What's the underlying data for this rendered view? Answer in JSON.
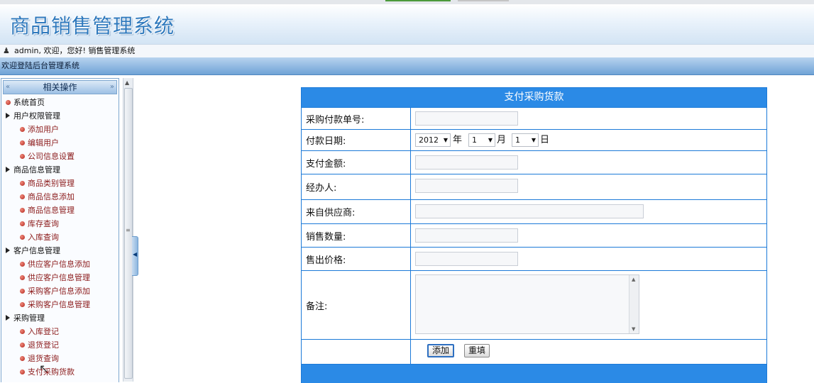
{
  "app": {
    "title": "商品销售管理系统",
    "user_line": "admin, 欢迎，您好! 销售管理系统",
    "welcome": "欢迎登陆后台管理系统"
  },
  "sidebar": {
    "header": "相关操作",
    "items": [
      {
        "label": "系统首页",
        "type": "item"
      },
      {
        "label": "用户权限管理",
        "type": "group"
      },
      {
        "label": "添加用户",
        "type": "sub"
      },
      {
        "label": "编辑用户",
        "type": "sub"
      },
      {
        "label": "公司信息设置",
        "type": "sub"
      },
      {
        "label": "商品信息管理",
        "type": "group"
      },
      {
        "label": "商品类别管理",
        "type": "sub"
      },
      {
        "label": "商品信息添加",
        "type": "sub"
      },
      {
        "label": "商品信息管理",
        "type": "sub"
      },
      {
        "label": "库存查询",
        "type": "sub"
      },
      {
        "label": "入库查询",
        "type": "sub"
      },
      {
        "label": "客户信息管理",
        "type": "group"
      },
      {
        "label": "供应客户信息添加",
        "type": "sub"
      },
      {
        "label": "供应客户信息管理",
        "type": "sub"
      },
      {
        "label": "采购客户信息添加",
        "type": "sub"
      },
      {
        "label": "采购客户信息管理",
        "type": "sub"
      },
      {
        "label": "采购管理",
        "type": "group"
      },
      {
        "label": "入库登记",
        "type": "sub"
      },
      {
        "label": "退货登记",
        "type": "sub"
      },
      {
        "label": "退货查询",
        "type": "sub"
      },
      {
        "label": "支付采购货款",
        "type": "sub"
      }
    ]
  },
  "form": {
    "title": "支付采购货款",
    "labels": {
      "order_no": "采购付款单号:",
      "date": "付款日期:",
      "amount": "支付金额:",
      "handler": "经办人:",
      "supplier": "来自供应商:",
      "quantity": "销售数量:",
      "price": "售出价格:",
      "remark": "备注:"
    },
    "values": {
      "order_no": "",
      "amount": "",
      "handler": "",
      "supplier": "",
      "quantity": "",
      "price": "",
      "remark": ""
    },
    "date": {
      "year": "2012",
      "year_unit": "年",
      "month": "1",
      "month_unit": "月",
      "day": "1",
      "day_unit": "日"
    },
    "buttons": {
      "submit": "添加",
      "reset": "重填"
    }
  },
  "icons": {
    "user": "user-icon",
    "bullet": "red-bullet-icon",
    "expand": "triangle-right-icon"
  },
  "colors": {
    "accent": "#2b8ae6",
    "title_text": "#2f79bd",
    "sub_item_text": "#8b1a1a"
  }
}
